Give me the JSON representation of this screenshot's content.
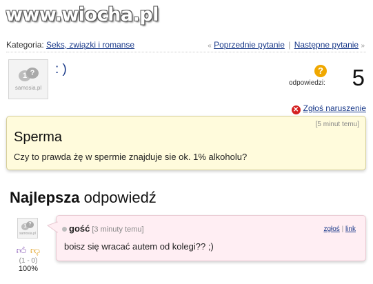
{
  "watermark": "www.wiocha.pl",
  "topbar": {
    "category_label": "Kategoria:",
    "category_link": "Seks, związki i romanse",
    "prev_arrow": "«",
    "prev_link": "Poprzednie pytanie",
    "separator": "|",
    "next_link": "Następne pytanie",
    "next_arrow": "»"
  },
  "question": {
    "avatar_label": "samosia.pl",
    "nickname": ": )",
    "answers_icon": "question-mark-icon",
    "answers_label": "odpowiedzi:",
    "answers_count": "5",
    "report_label": "Zgłoś naruszenie",
    "time": "[5 minut temu]",
    "title": "Sperma",
    "body": "Czy to prawda żę w spermie znajduje sie ok. 1% alkoholu?"
  },
  "best_answer": {
    "heading_bold": "Najlepsza",
    "heading_rest": " odpowiedź",
    "avatar_label": "samosia.pl",
    "author": "gość",
    "time": "[3 minuty temu]",
    "report_link": "zgłoś",
    "link_link": "link",
    "text": "boisz się wracać autem od kolegi?? ;)",
    "votes": "(1 - 0)",
    "percent": "100%"
  },
  "colors": {
    "link": "#1a3a8a",
    "question_bg": "#fffbdc",
    "answer_bg": "#ffeef3",
    "badge": "#f0a800",
    "report_icon": "#d42020"
  }
}
